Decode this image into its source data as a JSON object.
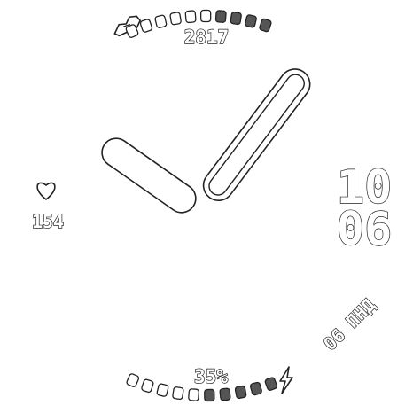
{
  "steps": {
    "value": "2817",
    "segments_total": 10,
    "segments_filled": 4,
    "icon": "running-shoe-icon"
  },
  "heart": {
    "value": "154",
    "icon": "heart-icon"
  },
  "time": {
    "hour": "10",
    "minute": "06"
  },
  "date": {
    "text": "06 ПНД"
  },
  "battery": {
    "value": "35%",
    "segments_total": 10,
    "segments_filled": 4,
    "icon": "lightning-bolt-icon"
  },
  "colors": {
    "background": "#ffffff",
    "outline": "#222222",
    "segment_filled": "#555555",
    "segment_empty": "#ffffff"
  }
}
